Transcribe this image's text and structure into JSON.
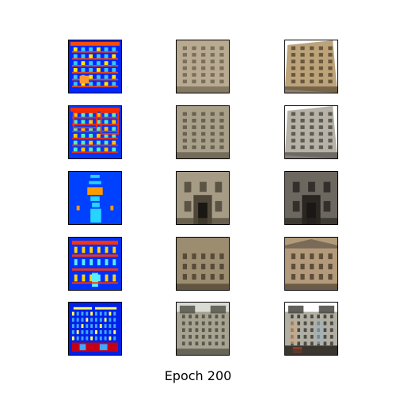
{
  "caption": "Epoch 200",
  "columns": [
    "label-map",
    "generated",
    "ground-truth"
  ],
  "rows": [
    {
      "label": {
        "bg": "#0026ff",
        "accent": "#ff4a00",
        "mid": "#36c8ff",
        "hi": "#ffe800",
        "pattern": "windows-grid"
      },
      "generated": {
        "tone": "#b9ab92",
        "shade": "#6e6450",
        "sky": "#e7e2da",
        "type": "tall-facade"
      },
      "real": {
        "tone": "#bca37a",
        "shade": "#5a4a34",
        "sky": "#ffffff",
        "type": "tall-facade-skew"
      }
    },
    {
      "label": {
        "bg": "#0037ff",
        "accent": "#ff2a00",
        "mid": "#4ef0c0",
        "hi": "#ffc200",
        "pattern": "windows-grid-red"
      },
      "generated": {
        "tone": "#a9a08a",
        "shade": "#5e5646",
        "sky": "#e3ddd2",
        "type": "tall-facade"
      },
      "real": {
        "tone": "#b7b2a8",
        "shade": "#4f4a44",
        "sky": "#ffffff",
        "type": "ornate-facade-skew"
      }
    },
    {
      "label": {
        "bg": "#0040ff",
        "accent": "#ff9a00",
        "mid": "#27d4ff",
        "hi": "#ffffff",
        "pattern": "centered-portal"
      },
      "generated": {
        "tone": "#a69c86",
        "shade": "#4e4638",
        "sky": "#dcd7cd",
        "type": "ornate-portal"
      },
      "real": {
        "tone": "#6c6860",
        "shade": "#2a2622",
        "sky": "#ffffff",
        "type": "dark-portal"
      }
    },
    {
      "label": {
        "bg": "#0030ff",
        "accent": "#ff3300",
        "mid": "#58f0ff",
        "hi": "#ffd400",
        "pattern": "classical-rows"
      },
      "generated": {
        "tone": "#9c8c70",
        "shade": "#4a3f2e",
        "sky": "#e0d9cc",
        "type": "classical"
      },
      "real": {
        "tone": "#b29a7a",
        "shade": "#4e4030",
        "sky": "#ffffff",
        "type": "classical-roof"
      }
    },
    {
      "label": {
        "bg": "#0020e8",
        "accent": "#c40018",
        "mid": "#3fa8ff",
        "hi": "#ffff60",
        "pattern": "dense-street"
      },
      "generated": {
        "tone": "#a7a391",
        "shade": "#4a4a40",
        "sky": "#d9dbd5",
        "type": "street-block"
      },
      "real": {
        "tone": "#b1aea4",
        "shade": "#3a3832",
        "sky": "#ffffff",
        "type": "street-block-colorful"
      }
    }
  ]
}
